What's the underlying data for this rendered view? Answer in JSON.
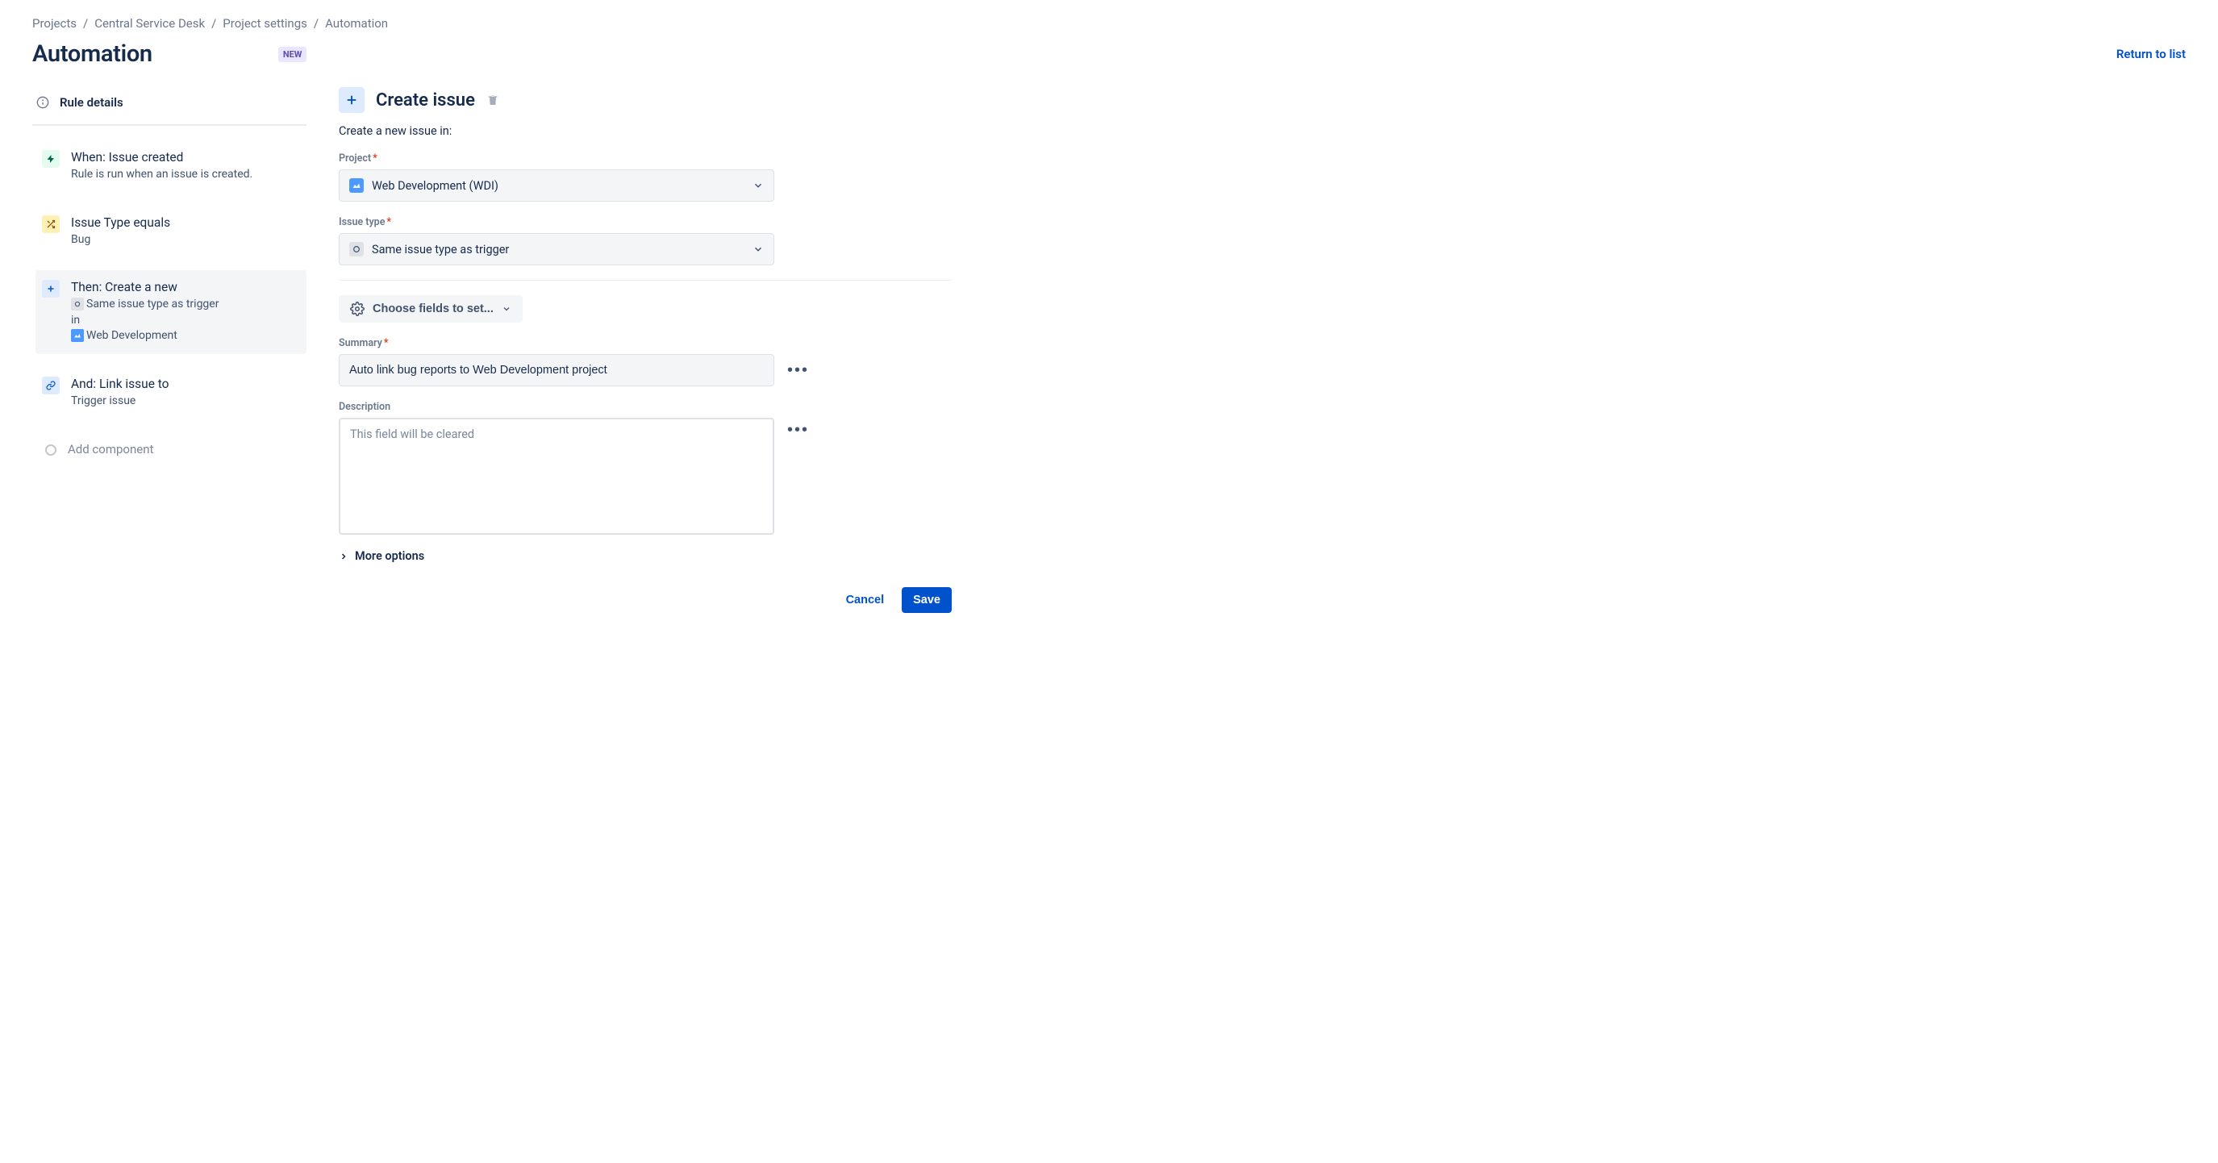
{
  "breadcrumb": {
    "projects": "Projects",
    "service_desk": "Central Service Desk",
    "project_settings": "Project settings",
    "automation": "Automation"
  },
  "header": {
    "title": "Automation",
    "badge": "NEW",
    "return_link": "Return to list"
  },
  "sidebar": {
    "rule_details": "Rule details",
    "steps": {
      "when": {
        "title": "When: Issue created",
        "sub": "Rule is run when an issue is created."
      },
      "condition": {
        "title": "Issue Type equals",
        "sub": "Bug"
      },
      "then": {
        "title": "Then: Create a new",
        "sub_issuetype": "Same issue type as trigger",
        "sub_in": "in",
        "sub_project": "Web Development"
      },
      "and": {
        "title": "And: Link issue to",
        "sub": "Trigger issue"
      },
      "add_component": "Add component"
    }
  },
  "panel": {
    "title": "Create issue",
    "subtitle": "Create a new issue in:",
    "project": {
      "label": "Project",
      "value": "Web Development (WDI)"
    },
    "issue_type": {
      "label": "Issue type",
      "value": "Same issue type as trigger"
    },
    "choose_fields": "Choose fields to set...",
    "summary": {
      "label": "Summary",
      "value": "Auto link bug reports to Web Development project"
    },
    "description": {
      "label": "Description",
      "placeholder": "This field will be cleared"
    },
    "more_options": "More options",
    "cancel": "Cancel",
    "save": "Save"
  }
}
